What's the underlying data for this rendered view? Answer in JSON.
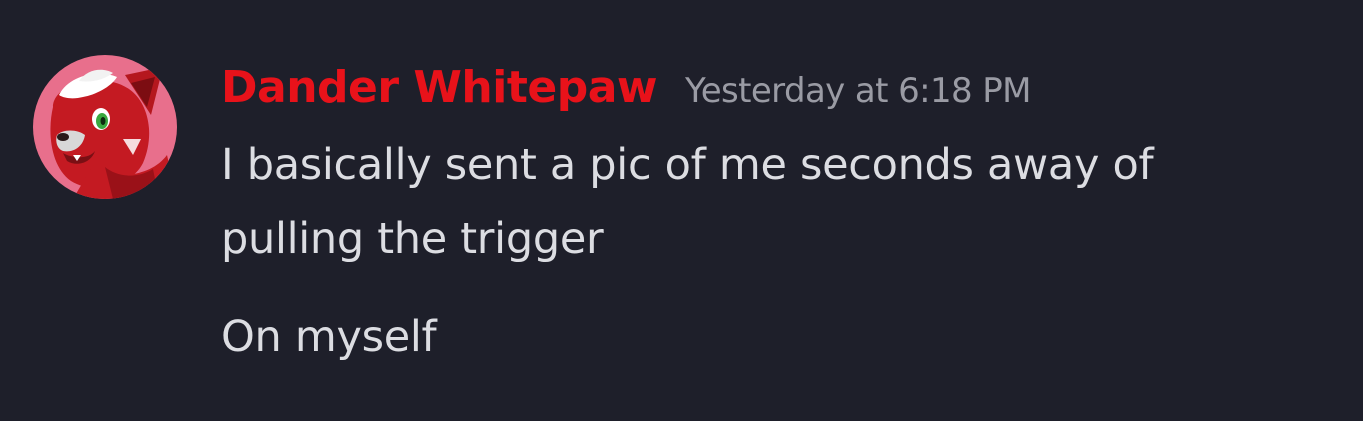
{
  "message": {
    "author": "Dander Whitepaw",
    "timestamp": "Yesterday at 6:18 PM",
    "lines": [
      "I basically sent a pic of me seconds away of",
      "pulling the trigger",
      "On myself"
    ]
  },
  "avatar": {
    "icon": "red-wolf-fursona-avatar-icon"
  },
  "colors": {
    "background": "#1e1f2a",
    "author": "#e8121a",
    "timestamp": "#9a9ba4",
    "text": "#dcdde2",
    "avatar_background": "#e86f8c"
  }
}
